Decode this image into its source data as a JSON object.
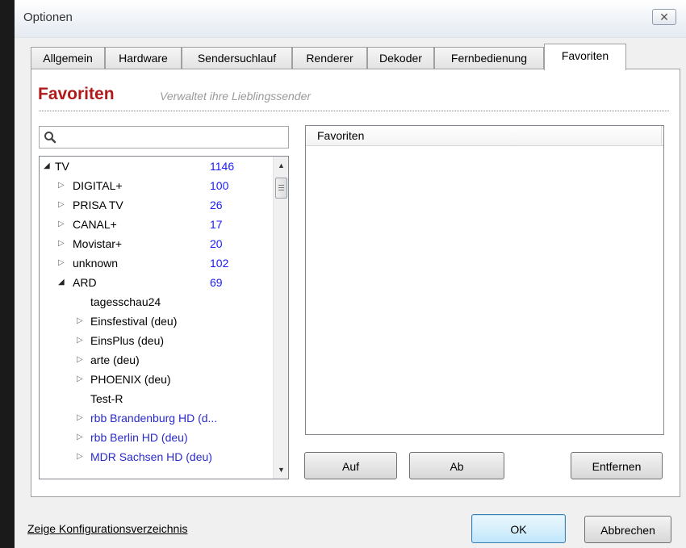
{
  "window": {
    "title": "Optionen",
    "close_glyph": "✕"
  },
  "tabs": [
    {
      "label": "Allgemein"
    },
    {
      "label": "Hardware"
    },
    {
      "label": "Sendersuchlauf"
    },
    {
      "label": "Renderer"
    },
    {
      "label": "Dekoder"
    },
    {
      "label": "Fernbedienung"
    },
    {
      "label": "Favoriten",
      "active": true
    }
  ],
  "header": {
    "title": "Favoriten",
    "subtitle": "Verwaltet ihre Lieblingssender"
  },
  "search": {
    "value": "",
    "placeholder": "",
    "icon": "search-icon"
  },
  "tree": {
    "rows": [
      {
        "label": "TV",
        "count": "1146",
        "expanded": true
      },
      {
        "label": "DIGITAL+",
        "count": "100"
      },
      {
        "label": "PRISA TV",
        "count": "26"
      },
      {
        "label": "CANAL+",
        "count": "17"
      },
      {
        "label": "Movistar+",
        "count": "20"
      },
      {
        "label": "unknown",
        "count": "102"
      },
      {
        "label": "ARD",
        "count": "69",
        "expanded": true
      },
      {
        "label": "tagesschau24"
      },
      {
        "label": "Einsfestival (deu)"
      },
      {
        "label": "EinsPlus (deu)"
      },
      {
        "label": "arte (deu)"
      },
      {
        "label": "PHOENIX (deu)"
      },
      {
        "label": "Test-R"
      },
      {
        "label": "rbb Brandenburg HD (d..."
      },
      {
        "label": "rbb Berlin HD (deu)"
      },
      {
        "label": "MDR Sachsen HD (deu)"
      }
    ]
  },
  "favorites": {
    "column_header": "Favoriten",
    "items": []
  },
  "buttons": {
    "up": "Auf",
    "down": "Ab",
    "remove": "Entfernen",
    "ok": "OK",
    "cancel": "Abbrechen"
  },
  "footer": {
    "config_link": "Zeige Konfigurationsverzeichnis"
  },
  "colors": {
    "header_title": "#b01a1a",
    "count_text": "#1a1aff",
    "hd_channel_text": "#2a2acc"
  }
}
